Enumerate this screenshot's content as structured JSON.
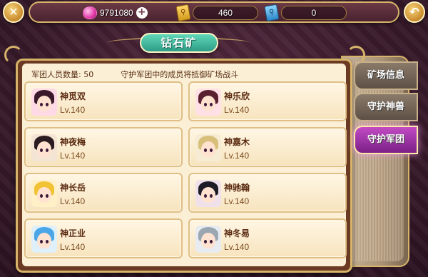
{
  "header": {
    "diamonds": "9791080",
    "tickets_gold": "460",
    "tickets_blue": "0"
  },
  "title": "钻石矿",
  "info": {
    "count_label": "军团人员数量: 50",
    "description": "守护军团中的成员将抵御矿场战斗"
  },
  "members": [
    {
      "name": "神觅双",
      "level": "Lv.140",
      "hair": "#3a1a2a"
    },
    {
      "name": "神乐欣",
      "level": "Lv.140",
      "hair": "#5a2030"
    },
    {
      "name": "神夜梅",
      "level": "Lv.140",
      "hair": "#2a1c20"
    },
    {
      "name": "神嘉木",
      "level": "Lv.140",
      "hair": "#d8c07a"
    },
    {
      "name": "神长岳",
      "level": "Lv.140",
      "hair": "#f2c235"
    },
    {
      "name": "神驰翰",
      "level": "Lv.140",
      "hair": "#1c1c26"
    },
    {
      "name": "神正业",
      "level": "Lv.140",
      "hair": "#4aa6e6"
    },
    {
      "name": "神冬易",
      "level": "Lv.140",
      "hair": "#9aa6b2"
    }
  ],
  "tabs": [
    {
      "label": "矿场信息"
    },
    {
      "label": "守护神兽"
    },
    {
      "label": "守护军团"
    }
  ],
  "icons": {
    "close": "close-icon",
    "back": "back-icon",
    "gem": "gem-icon",
    "add": "plus-icon",
    "ticket": "ticket-icon"
  },
  "colors": {
    "accent": "#d7b46a",
    "tab_active": "#a83aa8",
    "title_banner": "#3fb8a0",
    "card_bg": "#f7e4be"
  }
}
